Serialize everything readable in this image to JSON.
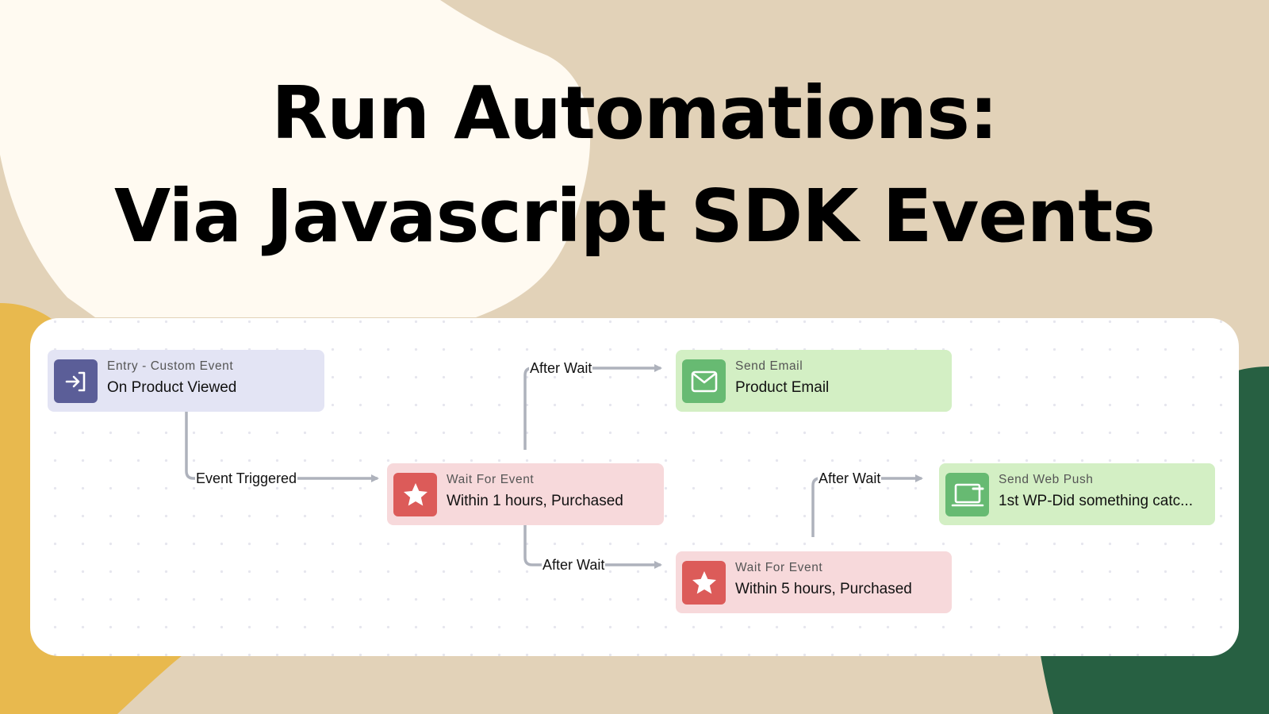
{
  "title": {
    "line1": "Run Automations:",
    "line2": "Via Javascript SDK Events"
  },
  "colors": {
    "background": "#e2d2b8",
    "cream_blob": "#fffaf1",
    "yellow_blob": "#e8b94e",
    "green_blob": "#276042",
    "entry_node": "#e3e4f4",
    "entry_icon": "#5b5e98",
    "wait_node": "#f7d9db",
    "wait_icon": "#dc5b59",
    "send_node": "#d3efc4",
    "send_icon": "#67ba72",
    "edge": "#aeb2bc"
  },
  "workflow": {
    "nodes": [
      {
        "id": "entry",
        "type": "entry",
        "icon": "enter-icon",
        "subtitle": "Entry - Custom Event",
        "label": "On Product Viewed"
      },
      {
        "id": "wait1",
        "type": "wait",
        "icon": "star-icon",
        "subtitle": "Wait For Event",
        "label": "Within 1 hours, Purchased"
      },
      {
        "id": "email",
        "type": "send",
        "icon": "mail-icon",
        "subtitle": "Send Email",
        "label": "Product Email"
      },
      {
        "id": "wait2",
        "type": "wait",
        "icon": "star-icon",
        "subtitle": "Wait For Event",
        "label": "Within 5 hours, Purchased"
      },
      {
        "id": "webpush",
        "type": "send",
        "icon": "web-push-icon",
        "subtitle": "Send Web Push",
        "label": "1st WP-Did something catc..."
      }
    ],
    "edges": [
      {
        "from": "entry",
        "to": "wait1",
        "label": "Event Triggered"
      },
      {
        "from": "wait1",
        "to": "email",
        "label": "After Wait"
      },
      {
        "from": "wait1",
        "to": "wait2",
        "label": "After Wait"
      },
      {
        "from": "wait2",
        "to": "webpush",
        "label": "After Wait"
      }
    ]
  }
}
